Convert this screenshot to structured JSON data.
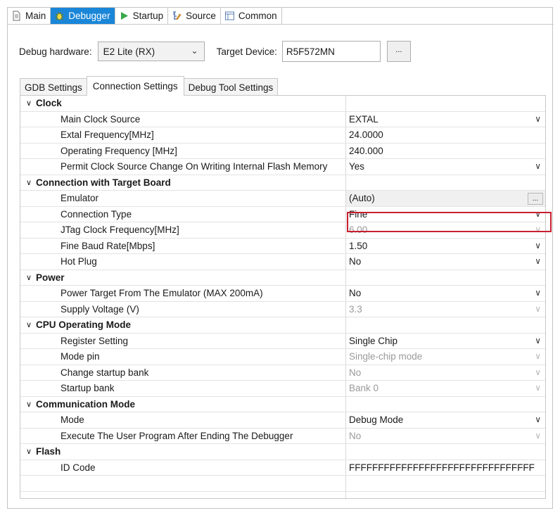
{
  "tabs": [
    {
      "label": "Main",
      "icon": "document-icon"
    },
    {
      "label": "Debugger",
      "icon": "bug-icon",
      "active": true
    },
    {
      "label": "Startup",
      "icon": "play-icon"
    },
    {
      "label": "Source",
      "icon": "source-icon"
    },
    {
      "label": "Common",
      "icon": "window-icon"
    }
  ],
  "debug_hardware": {
    "label": "Debug hardware:",
    "value": "E2 Lite (RX)"
  },
  "target_device": {
    "label": "Target Device:",
    "value": "R5F572MN",
    "browse_label": "..."
  },
  "subtabs": [
    {
      "label": "GDB Settings"
    },
    {
      "label": "Connection Settings",
      "active": true
    },
    {
      "label": "Debug Tool Settings"
    }
  ],
  "grid": {
    "rows": [
      {
        "kind": "category",
        "label": "Clock"
      },
      {
        "kind": "prop",
        "label": "Main Clock Source",
        "value": "EXTAL",
        "dropdown": true
      },
      {
        "kind": "prop",
        "label": "Extal Frequency[MHz]",
        "value": "24.0000"
      },
      {
        "kind": "prop",
        "label": "Operating Frequency [MHz]",
        "value": "240.000"
      },
      {
        "kind": "prop",
        "label": "Permit Clock Source Change On Writing Internal Flash Memory",
        "value": "Yes",
        "dropdown": true
      },
      {
        "kind": "category",
        "label": "Connection with Target Board"
      },
      {
        "kind": "prop",
        "label": "Emulator",
        "value": "(Auto)",
        "ellipsis": "...",
        "readonly": true
      },
      {
        "kind": "prop",
        "label": "Connection Type",
        "value": "Fine",
        "dropdown": true,
        "highlighted": true
      },
      {
        "kind": "prop",
        "label": "JTag Clock Frequency[MHz]",
        "value": "6.00",
        "dropdown": true,
        "disabled": true
      },
      {
        "kind": "prop",
        "label": "Fine Baud Rate[Mbps]",
        "value": "1.50",
        "dropdown": true
      },
      {
        "kind": "prop",
        "label": "Hot Plug",
        "value": "No",
        "dropdown": true
      },
      {
        "kind": "category",
        "label": "Power"
      },
      {
        "kind": "prop",
        "label": "Power Target From The Emulator (MAX 200mA)",
        "value": "No",
        "dropdown": true
      },
      {
        "kind": "prop",
        "label": "Supply Voltage (V)",
        "value": "3.3",
        "dropdown": true,
        "disabled": true
      },
      {
        "kind": "category",
        "label": "CPU Operating Mode"
      },
      {
        "kind": "prop",
        "label": "Register Setting",
        "value": "Single Chip",
        "dropdown": true
      },
      {
        "kind": "prop",
        "label": "Mode pin",
        "value": "Single-chip mode",
        "dropdown": true,
        "disabled": true
      },
      {
        "kind": "prop",
        "label": "Change startup bank",
        "value": "No",
        "dropdown": true,
        "disabled": true
      },
      {
        "kind": "prop",
        "label": "Startup bank",
        "value": "Bank 0",
        "dropdown": true,
        "disabled": true
      },
      {
        "kind": "category",
        "label": "Communication Mode"
      },
      {
        "kind": "prop",
        "label": "Mode",
        "value": "Debug Mode",
        "dropdown": true
      },
      {
        "kind": "prop",
        "label": "Execute The User Program After Ending The Debugger",
        "value": "No",
        "dropdown": true,
        "disabled": true
      },
      {
        "kind": "category",
        "label": "Flash"
      },
      {
        "kind": "prop",
        "label": "ID Code",
        "value": "FFFFFFFFFFFFFFFFFFFFFFFFFFFFFFFF"
      },
      {
        "kind": "empty"
      },
      {
        "kind": "empty"
      }
    ]
  },
  "colors": {
    "active_tab": "#1a86d8",
    "highlight_border": "#c8202f",
    "disabled_text": "#9a9a9a"
  }
}
